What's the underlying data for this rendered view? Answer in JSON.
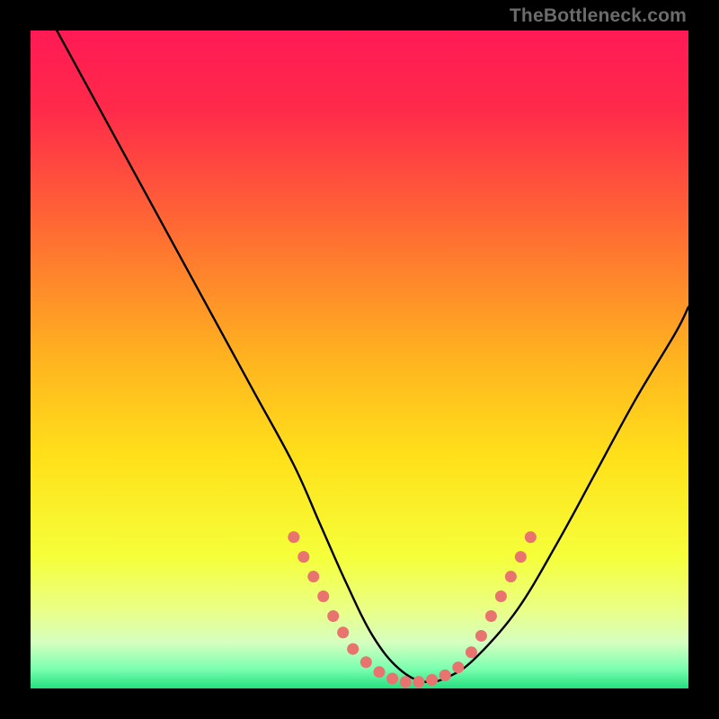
{
  "watermark": "TheBottleneck.com",
  "chart_data": {
    "type": "line",
    "title": "",
    "xlabel": "",
    "ylabel": "",
    "xlim": [
      0,
      100
    ],
    "ylim": [
      0,
      100
    ],
    "gradient_stops": [
      {
        "offset": 0.0,
        "color": "#ff1a55"
      },
      {
        "offset": 0.12,
        "color": "#ff2a4a"
      },
      {
        "offset": 0.3,
        "color": "#ff6a33"
      },
      {
        "offset": 0.5,
        "color": "#ffb41f"
      },
      {
        "offset": 0.65,
        "color": "#ffe11a"
      },
      {
        "offset": 0.8,
        "color": "#f5ff3a"
      },
      {
        "offset": 0.88,
        "color": "#eaff86"
      },
      {
        "offset": 0.93,
        "color": "#d6ffc0"
      },
      {
        "offset": 0.97,
        "color": "#7cffb0"
      },
      {
        "offset": 1.0,
        "color": "#25e07f"
      }
    ],
    "series": [
      {
        "name": "bottleneck-curve",
        "x": [
          4,
          10,
          16,
          22,
          28,
          34,
          40,
          44,
          48,
          52,
          56,
          60,
          64,
          68,
          74,
          80,
          86,
          92,
          98,
          100
        ],
        "y": [
          100,
          89,
          78,
          67,
          56,
          45,
          34,
          25,
          16,
          8,
          3,
          1,
          2,
          5,
          12,
          22,
          33,
          44,
          54,
          58
        ]
      }
    ],
    "markers": {
      "name": "highlight-dots",
      "color": "#e9736e",
      "points": [
        {
          "x": 40,
          "y": 23
        },
        {
          "x": 41.5,
          "y": 20
        },
        {
          "x": 43,
          "y": 17
        },
        {
          "x": 44.5,
          "y": 14
        },
        {
          "x": 46,
          "y": 11
        },
        {
          "x": 47.5,
          "y": 8.5
        },
        {
          "x": 49,
          "y": 6
        },
        {
          "x": 51,
          "y": 4
        },
        {
          "x": 53,
          "y": 2.5
        },
        {
          "x": 55,
          "y": 1.5
        },
        {
          "x": 57,
          "y": 1.0
        },
        {
          "x": 59,
          "y": 1.0
        },
        {
          "x": 61,
          "y": 1.3
        },
        {
          "x": 63,
          "y": 2.0
        },
        {
          "x": 65,
          "y": 3.2
        },
        {
          "x": 67,
          "y": 5.5
        },
        {
          "x": 68.5,
          "y": 8
        },
        {
          "x": 70,
          "y": 11
        },
        {
          "x": 71.5,
          "y": 14
        },
        {
          "x": 73,
          "y": 17
        },
        {
          "x": 74.5,
          "y": 20
        },
        {
          "x": 76,
          "y": 23
        }
      ]
    }
  }
}
